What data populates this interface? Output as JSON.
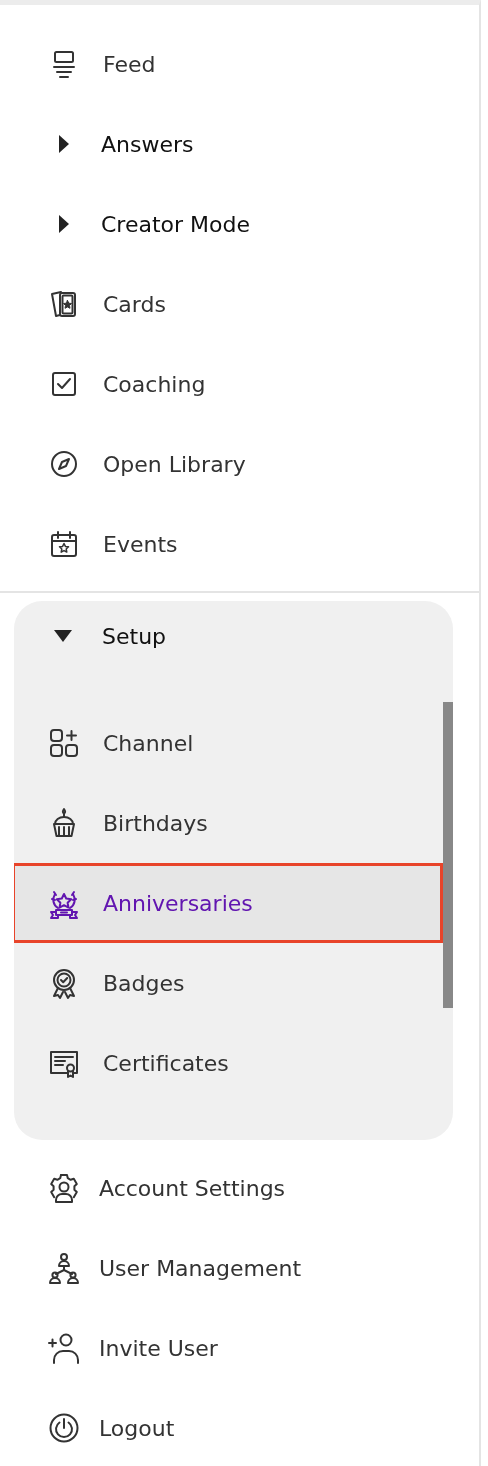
{
  "sidebar": {
    "items": [
      {
        "kind": "link",
        "label": "Feed"
      },
      {
        "kind": "group",
        "label": "Answers",
        "expanded": false
      },
      {
        "kind": "group",
        "label": "Creator Mode",
        "expanded": false
      },
      {
        "kind": "link",
        "label": "Cards"
      },
      {
        "kind": "link",
        "label": "Coaching"
      },
      {
        "kind": "link",
        "label": "Open Library"
      },
      {
        "kind": "link",
        "label": "Events"
      }
    ],
    "setup": {
      "label": "Setup",
      "expanded": true,
      "children": [
        {
          "label": "Channel",
          "selected": false
        },
        {
          "label": "Birthdays",
          "selected": false
        },
        {
          "label": "Anniversaries",
          "selected": true
        },
        {
          "label": "Badges",
          "selected": false
        },
        {
          "label": "Certificates",
          "selected": false
        }
      ]
    },
    "footer_items": [
      {
        "label": "Account Settings"
      },
      {
        "label": "User Management"
      },
      {
        "label": "Invite User"
      },
      {
        "label": "Logout"
      }
    ]
  }
}
